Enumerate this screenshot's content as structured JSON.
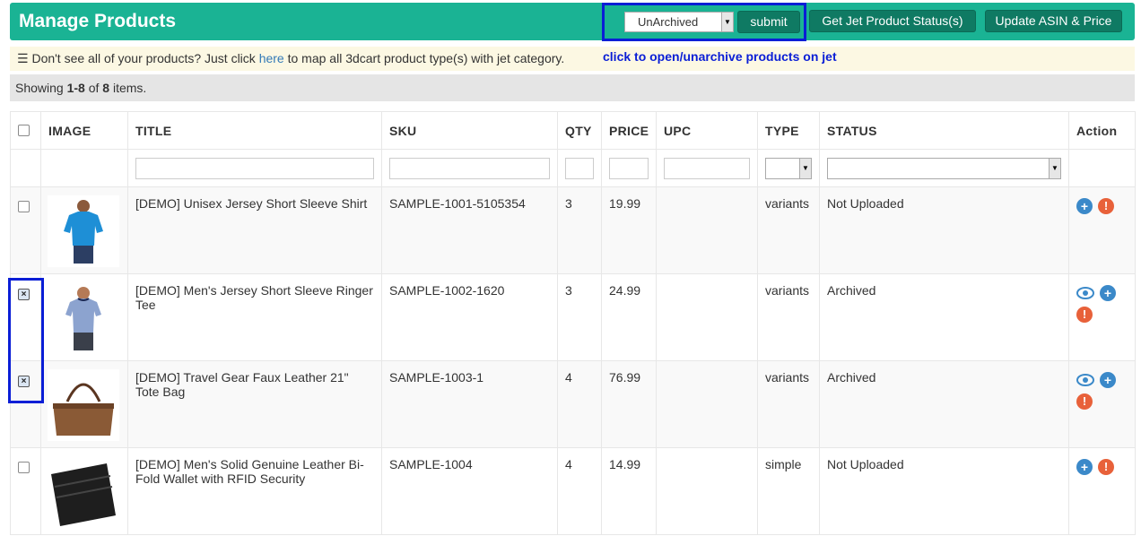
{
  "header": {
    "title": "Manage Products",
    "archive_select_value": "UnArchived",
    "submit_label": "submit",
    "get_status_label": "Get Jet Product Status(s)",
    "update_asin_label": "Update ASIN & Price"
  },
  "info": {
    "prefix": "Don't see all of your products? Just click ",
    "link": "here",
    "suffix": " to map all 3dcart product type(s) with jet category."
  },
  "hint": "click to open/unarchive products on jet",
  "summary": {
    "prefix": "Showing ",
    "range": "1-8",
    "of": " of ",
    "total": "8",
    "suffix": " items."
  },
  "columns": [
    "IMAGE",
    "TITLE",
    "SKU",
    "QTY",
    "PRICE",
    "UPC",
    "TYPE",
    "STATUS",
    "Action"
  ],
  "rows": [
    {
      "checked": false,
      "image": "blue-tshirt",
      "title": "[DEMO] Unisex Jersey Short Sleeve Shirt",
      "sku": "SAMPLE-1001-5105354",
      "qty": "3",
      "price": "19.99",
      "upc": "",
      "type": "variants",
      "status": "Not Uploaded",
      "actions": [
        "plus-icon",
        "warning-icon"
      ]
    },
    {
      "checked": true,
      "image": "ringer-tee",
      "title": "[DEMO] Men's Jersey Short Sleeve Ringer Tee",
      "sku": "SAMPLE-1002-1620",
      "qty": "3",
      "price": "24.99",
      "upc": "",
      "type": "variants",
      "status": "Archived",
      "actions": [
        "eye-icon",
        "plus-icon",
        "warning-icon"
      ]
    },
    {
      "checked": true,
      "image": "tote-bag",
      "title": "[DEMO] Travel Gear Faux Leather 21\" Tote Bag",
      "sku": "SAMPLE-1003-1",
      "qty": "4",
      "price": "76.99",
      "upc": "",
      "type": "variants",
      "status": "Archived",
      "actions": [
        "eye-icon",
        "plus-icon",
        "warning-icon"
      ]
    },
    {
      "checked": false,
      "image": "wallet",
      "title": "[DEMO] Men's Solid Genuine Leather Bi-Fold Wallet with RFID Security",
      "sku": "SAMPLE-1004",
      "qty": "4",
      "price": "14.99",
      "upc": "",
      "type": "simple",
      "status": "Not Uploaded",
      "actions": [
        "plus-icon",
        "warning-icon"
      ]
    }
  ],
  "colors": {
    "header": "#1ab394",
    "button": "#0f7a63",
    "highlight": "#0a1ed6",
    "info_bg": "#fcf8e3"
  }
}
